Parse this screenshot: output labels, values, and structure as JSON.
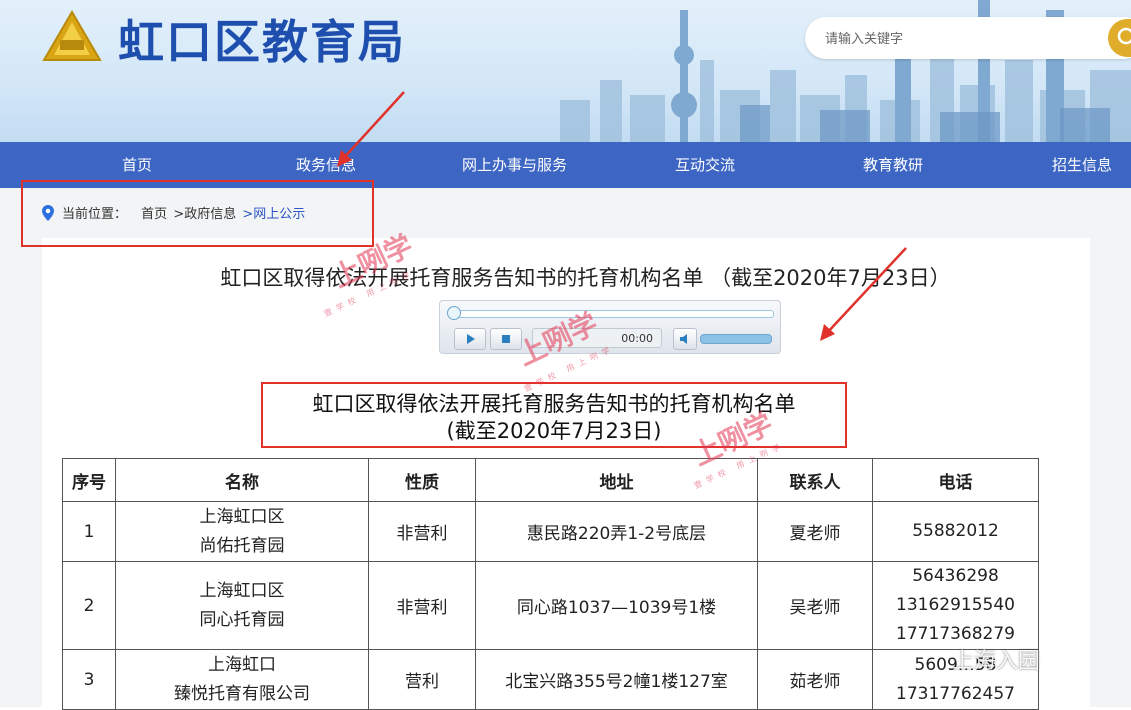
{
  "header": {
    "site_title": "虹口区教育局",
    "logo_icon": "hongkou-emblem-icon",
    "search": {
      "placeholder": "请输入关键字",
      "icon": "search-icon",
      "accent": "#e0ad2a"
    }
  },
  "nav": {
    "items": [
      "首页",
      "政务信息",
      "网上办事与服务",
      "互动交流",
      "教育教研",
      "招生信息"
    ],
    "background": "#3d66c4"
  },
  "breadcrumb": {
    "icon": "location-pin-icon",
    "label": "当前位置：",
    "items": [
      "首页",
      ">政府信息",
      ">网上公示"
    ]
  },
  "article": {
    "title": "虹口区取得依法开展托育服务告知书的托育机构名单 （截至2020年7月23日）",
    "player": {
      "time": "00:00",
      "progress": 0,
      "volume": 1.0
    },
    "doc_title_line1": "虹口区取得依法开展托育服务告知书的托育机构名单",
    "doc_title_line2": "(截至2020年7月23日)"
  },
  "table": {
    "headers": [
      "序号",
      "名称",
      "性质",
      "地址",
      "联系人",
      "电话"
    ],
    "rows": [
      {
        "no": "1",
        "name": [
          "上海虹口区",
          "尚佑托育园"
        ],
        "type": "非营利",
        "address": "惠民路220弄1-2号底层",
        "contact": "夏老师",
        "phones": [
          "55882012"
        ]
      },
      {
        "no": "2",
        "name": [
          "上海虹口区",
          "同心托育园"
        ],
        "type": "非营利",
        "address": "同心路1037—1039号1楼",
        "contact": "吴老师",
        "phones": [
          "56436298",
          "13162915540",
          "17717368279"
        ]
      },
      {
        "no": "3",
        "name": [
          "上海虹口",
          "臻悦托育有限公司"
        ],
        "type": "营利",
        "address": "北宝兴路355号2幢1楼127室",
        "contact": "茹老师",
        "phones": [
          "5609…58",
          "17317762457"
        ]
      }
    ]
  },
  "watermarks": {
    "brand": "上咧学",
    "slogan": "壹学校 用上咧学",
    "account": "上海入园",
    "color": "#e23654"
  }
}
